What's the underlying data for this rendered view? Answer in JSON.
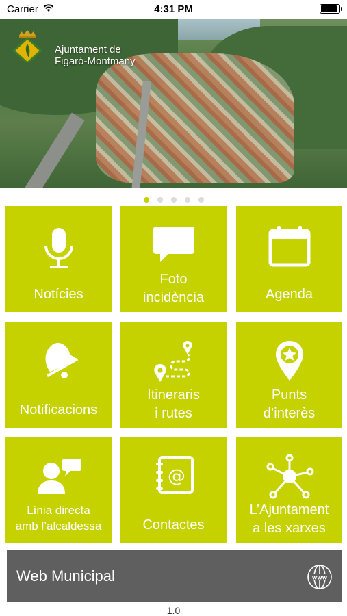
{
  "status_bar": {
    "carrier": "Carrier",
    "time": "4:31 PM",
    "battery_level": 0.9
  },
  "hero": {
    "logo_text_line1": "Ajuntament de",
    "logo_text_line2": "Figaró-Montmany",
    "logo_icon": "coat-of-arms-icon"
  },
  "carousel": {
    "page_count": 5,
    "active_index": 0
  },
  "accent_color": "#c6d100",
  "tiles": [
    {
      "label": "Notícies",
      "icon": "microphone-icon"
    },
    {
      "label1": "Foto",
      "label2": "incidència",
      "icon": "speech-bubble-icon"
    },
    {
      "label": "Agenda",
      "icon": "calendar-icon"
    },
    {
      "label": "Notificacions",
      "icon": "bell-icon"
    },
    {
      "label1": "Itineraris",
      "label2": "i rutes",
      "icon": "route-icon"
    },
    {
      "label1": "Punts",
      "label2": "d’interès",
      "icon": "map-pin-star-icon"
    },
    {
      "label1": "Línia directa",
      "label2": "amb l’alcaldessa",
      "icon": "person-chat-icon"
    },
    {
      "label": "Contactes",
      "icon": "address-book-icon"
    },
    {
      "label1": "L’Ajuntament",
      "label2": "a les xarxes",
      "icon": "network-icon"
    }
  ],
  "web_button": {
    "label": "Web Municipal",
    "icon": "www-globe-icon",
    "color": "#5f5f5f"
  },
  "version": "1.0"
}
